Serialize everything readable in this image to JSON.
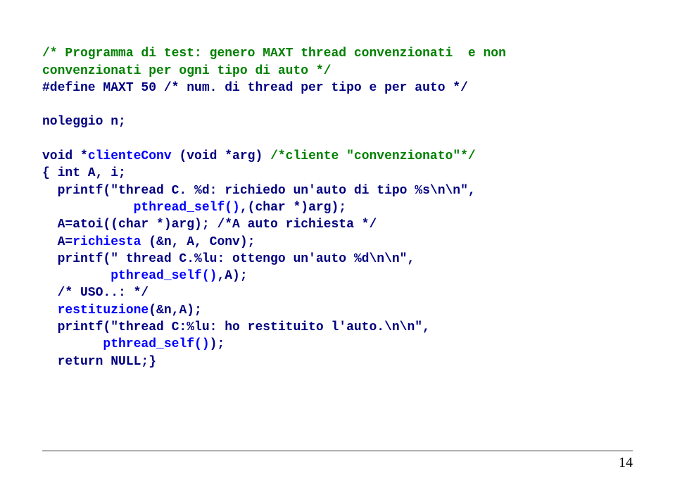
{
  "code": {
    "c1a": "/* Programma di test: genero MAXT thread convenzionati  e non",
    "c1b": "convenzionati per ogni tipo di auto */",
    "l2": "#define MAXT 50 /* num. di thread per tipo e per auto */",
    "blank1": "",
    "l3": "noleggio n;",
    "blank2": "",
    "l4a": "void *",
    "l4b": "clienteConv",
    "l4c": " (void *arg) ",
    "l4d": "/*cliente \"convenzionato\"*/",
    "l5": "{ int A, i;",
    "l6": "  printf(\"thread C. %d: richiedo un'auto di tipo %s\\n\\n\",",
    "l7a": "            ",
    "l7b": "pthread_self()",
    "l7c": ",(char *)arg);",
    "l8": "  A=atoi((char *)arg); /*A auto richiesta */",
    "l9a": "  A=",
    "l9b": "richiesta",
    "l9c": " (&n, A, Conv);",
    "l10": "  printf(\" thread C.%lu: ottengo un'auto %d\\n\\n\",",
    "l11a": "         ",
    "l11b": "pthread_self()",
    "l11c": ",A);",
    "l12": "  /* USO..: */",
    "l13a": "  ",
    "l13b": "restituzione",
    "l13c": "(&n,A);",
    "l14": "  printf(\"thread C:%lu: ho restituito l'auto.\\n\\n\",",
    "l15a": "        ",
    "l15b": "pthread_self()",
    "l15c": ");",
    "l16": "  return NULL;}"
  },
  "page_number": "14"
}
